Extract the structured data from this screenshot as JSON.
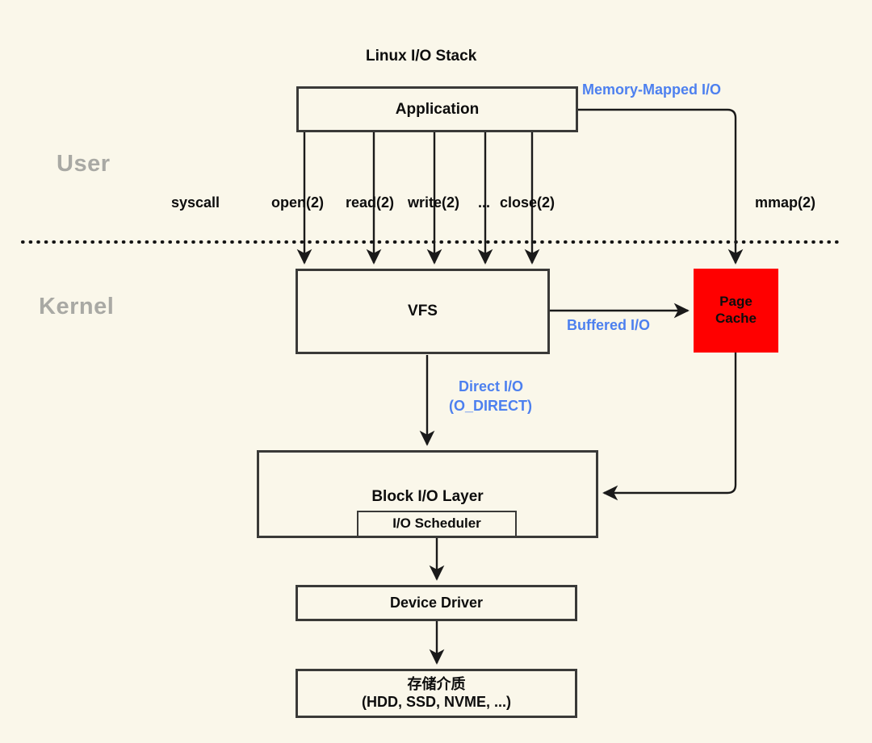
{
  "diagram": {
    "title": "Linux I/O Stack",
    "background_color": "#faf7ea",
    "zones": [
      {
        "id": "user",
        "label": "User"
      },
      {
        "id": "kernel",
        "label": "Kernel"
      }
    ],
    "boundary": {
      "style": "dotted",
      "label": ""
    },
    "nodes": [
      {
        "id": "application",
        "label": "Application",
        "fill": "#faf7ea",
        "stroke": "#3a3a38"
      },
      {
        "id": "vfs",
        "label": "VFS",
        "fill": "#faf7ea",
        "stroke": "#3a3a38"
      },
      {
        "id": "page_cache",
        "label_line1": "Page",
        "label_line2": "Cache",
        "fill": "#ff0000",
        "stroke": "#ff0000"
      },
      {
        "id": "block_io_layer",
        "label": "Block I/O Layer",
        "fill": "#faf7ea",
        "stroke": "#3a3a38"
      },
      {
        "id": "io_scheduler",
        "label": "I/O Scheduler",
        "fill": "#faf7ea",
        "stroke": "#3a3a38"
      },
      {
        "id": "device_driver",
        "label": "Device Driver",
        "fill": "#faf7ea",
        "stroke": "#3a3a38"
      },
      {
        "id": "storage_media",
        "label_line1": "存储介质",
        "label_line2": "(HDD, SSD, NVME, ...)",
        "fill": "#faf7ea",
        "stroke": "#3a3a38"
      }
    ],
    "syscall_group_label": "syscall",
    "syscalls": [
      {
        "id": "open",
        "label": "open(2)"
      },
      {
        "id": "read",
        "label": "read(2)"
      },
      {
        "id": "write",
        "label": "write(2)"
      },
      {
        "id": "ellipsis",
        "label": "..."
      },
      {
        "id": "close",
        "label": "close(2)"
      }
    ],
    "mmap_syscall": {
      "id": "mmap",
      "label": "mmap(2)"
    },
    "path_labels": [
      {
        "id": "memory_mapped_io",
        "label": "Memory-Mapped I/O",
        "color": "#4d80ef"
      },
      {
        "id": "buffered_io",
        "label": "Buffered I/O",
        "color": "#4d80ef"
      },
      {
        "id": "direct_io_line1",
        "label": "Direct I/O",
        "color": "#4d80ef"
      },
      {
        "id": "direct_io_line2",
        "label": "(O_DIRECT)",
        "color": "#4d80ef"
      }
    ]
  }
}
